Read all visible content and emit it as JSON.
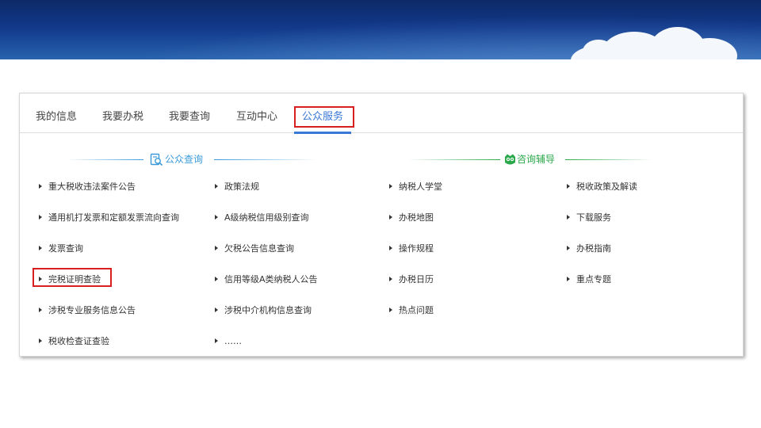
{
  "tabs": [
    {
      "label": "我的信息",
      "active": false
    },
    {
      "label": "我要办税",
      "active": false
    },
    {
      "label": "我要查询",
      "active": false
    },
    {
      "label": "互动中心",
      "active": false
    },
    {
      "label": "公众服务",
      "active": true
    }
  ],
  "sections": {
    "public_query": {
      "title": "公众查询",
      "icon": "search-document-icon",
      "color": "#3a9ad9"
    },
    "consult": {
      "title": "咨询辅导",
      "icon": "owl-icon",
      "color": "#2aa84a"
    }
  },
  "columns": [
    [
      "重大税收违法案件公告",
      "通用机打发票和定额发票流向查询",
      "发票查询",
      "完税证明查验",
      "涉税专业服务信息公告",
      "税收检查证查验"
    ],
    [
      "政策法规",
      "A级纳税信用级别查询",
      "欠税公告信息查询",
      "信用等级A类纳税人公告",
      "涉税中介机构信息查询",
      "……"
    ],
    [
      "纳税人学堂",
      "办税地图",
      "操作规程",
      "办税日历",
      "热点问题"
    ],
    [
      "税收政策及解读",
      "下载服务",
      "办税指南",
      "重点专题"
    ]
  ],
  "colors": {
    "accent": "#3a78d6",
    "highlight": "#d71f1f",
    "banner": "#12388a"
  }
}
